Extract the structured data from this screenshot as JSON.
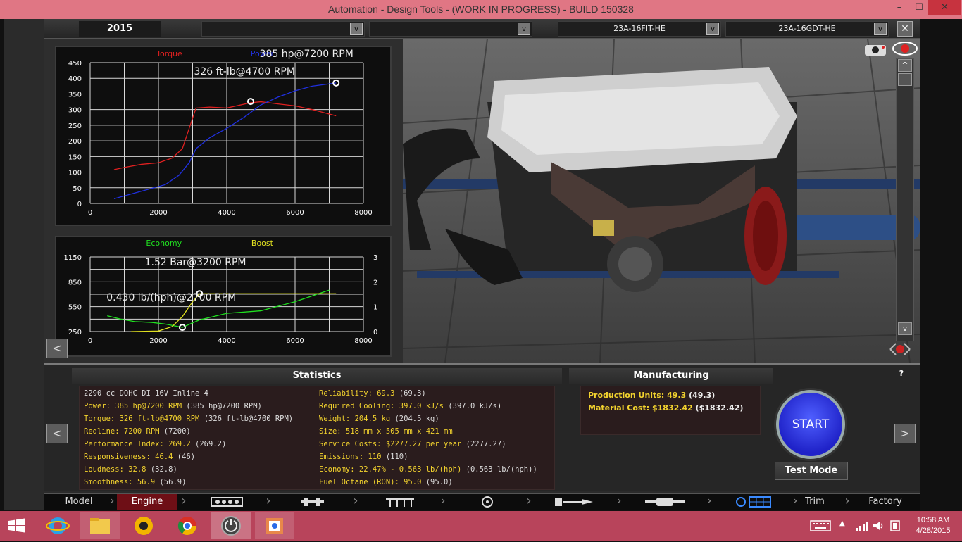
{
  "window": {
    "title": "Automation - Design Tools - (WORK IN PROGRESS) - BUILD 150328",
    "min": "–",
    "max": "☐",
    "close": "✕"
  },
  "topbar": {
    "year": "2015",
    "select1": "",
    "select2": "",
    "select3": "23A-16FIT-HE",
    "select4": "23A-16GDT-HE",
    "dropdown_arrow": "v",
    "close": "✕"
  },
  "chart_data": [
    {
      "type": "line",
      "x_ticks": [
        "0",
        "2000",
        "4000",
        "6000",
        "8000"
      ],
      "y_ticks": [
        "0",
        "50",
        "100",
        "150",
        "200",
        "250",
        "300",
        "350",
        "400",
        "450"
      ],
      "xlim": [
        0,
        8000
      ],
      "ylim": [
        0,
        450
      ],
      "grid": true,
      "legend": [
        "Torque",
        "Power"
      ],
      "series": [
        {
          "name": "Torque",
          "color": "#e02020",
          "x": [
            700,
            1000,
            1500,
            2000,
            2400,
            2700,
            2900,
            3100,
            3500,
            4000,
            4700,
            5000,
            5500,
            6000,
            6500,
            7200
          ],
          "y": [
            108,
            115,
            125,
            130,
            145,
            175,
            240,
            305,
            308,
            305,
            322,
            325,
            318,
            312,
            300,
            280
          ]
        },
        {
          "name": "Power",
          "color": "#2030e0",
          "x": [
            700,
            1200,
            1700,
            2200,
            2600,
            2900,
            3100,
            3500,
            4000,
            4500,
            5000,
            5500,
            6000,
            6500,
            7200
          ],
          "y": [
            15,
            30,
            45,
            60,
            90,
            130,
            175,
            210,
            240,
            275,
            315,
            340,
            360,
            375,
            385
          ]
        }
      ],
      "annotations": [
        "385 hp@7200 RPM",
        "326 ft-lb@4700 RPM"
      ],
      "markers": [
        {
          "x": 7200,
          "y": 385
        },
        {
          "x": 4700,
          "y": 326
        }
      ]
    },
    {
      "type": "line",
      "x_ticks": [
        "0",
        "2000",
        "4000",
        "6000",
        "8000"
      ],
      "y_ticks_left": [
        "250",
        "550",
        "850",
        "1150"
      ],
      "y_ticks_right": [
        "0",
        "1",
        "2",
        "3"
      ],
      "xlim": [
        0,
        8000
      ],
      "ylim_left": [
        250,
        1150
      ],
      "ylim_right": [
        0,
        3
      ],
      "grid": true,
      "legend": [
        "Economy",
        "Boost"
      ],
      "series": [
        {
          "name": "Economy",
          "color": "#20e020",
          "axis": "left",
          "x": [
            500,
            900,
            1300,
            1800,
            2200,
            2700,
            3200,
            4000,
            5000,
            6000,
            6500,
            7000
          ],
          "y": [
            440,
            400,
            370,
            360,
            340,
            300,
            390,
            470,
            500,
            610,
            680,
            750
          ]
        },
        {
          "name": "Boost",
          "color": "#e0e020",
          "axis": "right",
          "x": [
            1200,
            2000,
            2400,
            2700,
            3000,
            3200,
            4000,
            5000,
            6000,
            7200
          ],
          "y": [
            0,
            0.02,
            0.2,
            0.6,
            1.2,
            1.52,
            1.52,
            1.52,
            1.52,
            1.52
          ]
        }
      ],
      "annotations": [
        "1.52 Bar@3200 RPM",
        "0.430 lb/(hph)@2700 RPM"
      ],
      "markers": [
        {
          "x": 3200,
          "y": 1.52,
          "axis": "right"
        },
        {
          "x": 2700,
          "y": 300,
          "axis": "left"
        }
      ]
    }
  ],
  "back_label": "<",
  "statistics": {
    "title": "Statistics",
    "engine": "2290 cc DOHC DI 16V Inline 4",
    "left": [
      {
        "k": "Power: 385 hp@7200 RPM",
        "v": " (385 hp@7200 RPM)"
      },
      {
        "k": "Torque: 326 ft-lb@4700 RPM",
        "v": " (326 ft-lb@4700 RPM)"
      },
      {
        "k": "Redline: 7200 RPM",
        "v": " (7200)"
      },
      {
        "k": "Performance Index: 269.2",
        "v": " (269.2)"
      },
      {
        "k": "Responsiveness: 46.4",
        "v": " (46)"
      },
      {
        "k": "Loudness: 32.8",
        "v": " (32.8)"
      },
      {
        "k": "Smoothness: 56.9",
        "v": " (56.9)"
      }
    ],
    "right": [
      {
        "k": "Reliability: 69.3",
        "v": " (69.3)"
      },
      {
        "k": "Required Cooling: 397.0 kJ/s",
        "v": " (397.0 kJ/s)"
      },
      {
        "k": "Weight: 204.5 kg",
        "v": " (204.5 kg)"
      },
      {
        "k": "Size: 518 mm x 505 mm x 421 mm",
        "v": ""
      },
      {
        "k": "Service Costs: $2277.27 per year",
        "v": " (2277.27)"
      },
      {
        "k": "Emissions: 110",
        "v": " (110)"
      },
      {
        "k": "Economy: 22.47% - 0.563 lb/(hph)",
        "v": " (0.563 lb/(hph))"
      },
      {
        "k": "Fuel Octane (RON): 95.0",
        "v": " (95.0)"
      }
    ]
  },
  "manufacturing": {
    "title": "Manufacturing",
    "rows": [
      {
        "k": "Production Units: 49.3",
        "v": " (49.3)"
      },
      {
        "k": "Material Cost: $1832.42",
        "v": " ($1832.42)"
      }
    ]
  },
  "help": "?",
  "prev": "<",
  "next": ">",
  "start": "START",
  "test_mode": "Test Mode",
  "scroll_up": "^",
  "scroll_down": "v",
  "tabs": {
    "model": "Model",
    "engine": "Engine",
    "trim": "Trim",
    "factory": "Factory"
  },
  "clock": {
    "time": "10:58 AM",
    "date": "4/28/2015"
  },
  "colors": {
    "titlebar": "#e07684",
    "taskbar": "#b8445b",
    "stat_key": "#f2d22e",
    "active_tab": "#6e0f16",
    "start": "#2a2ee6"
  }
}
